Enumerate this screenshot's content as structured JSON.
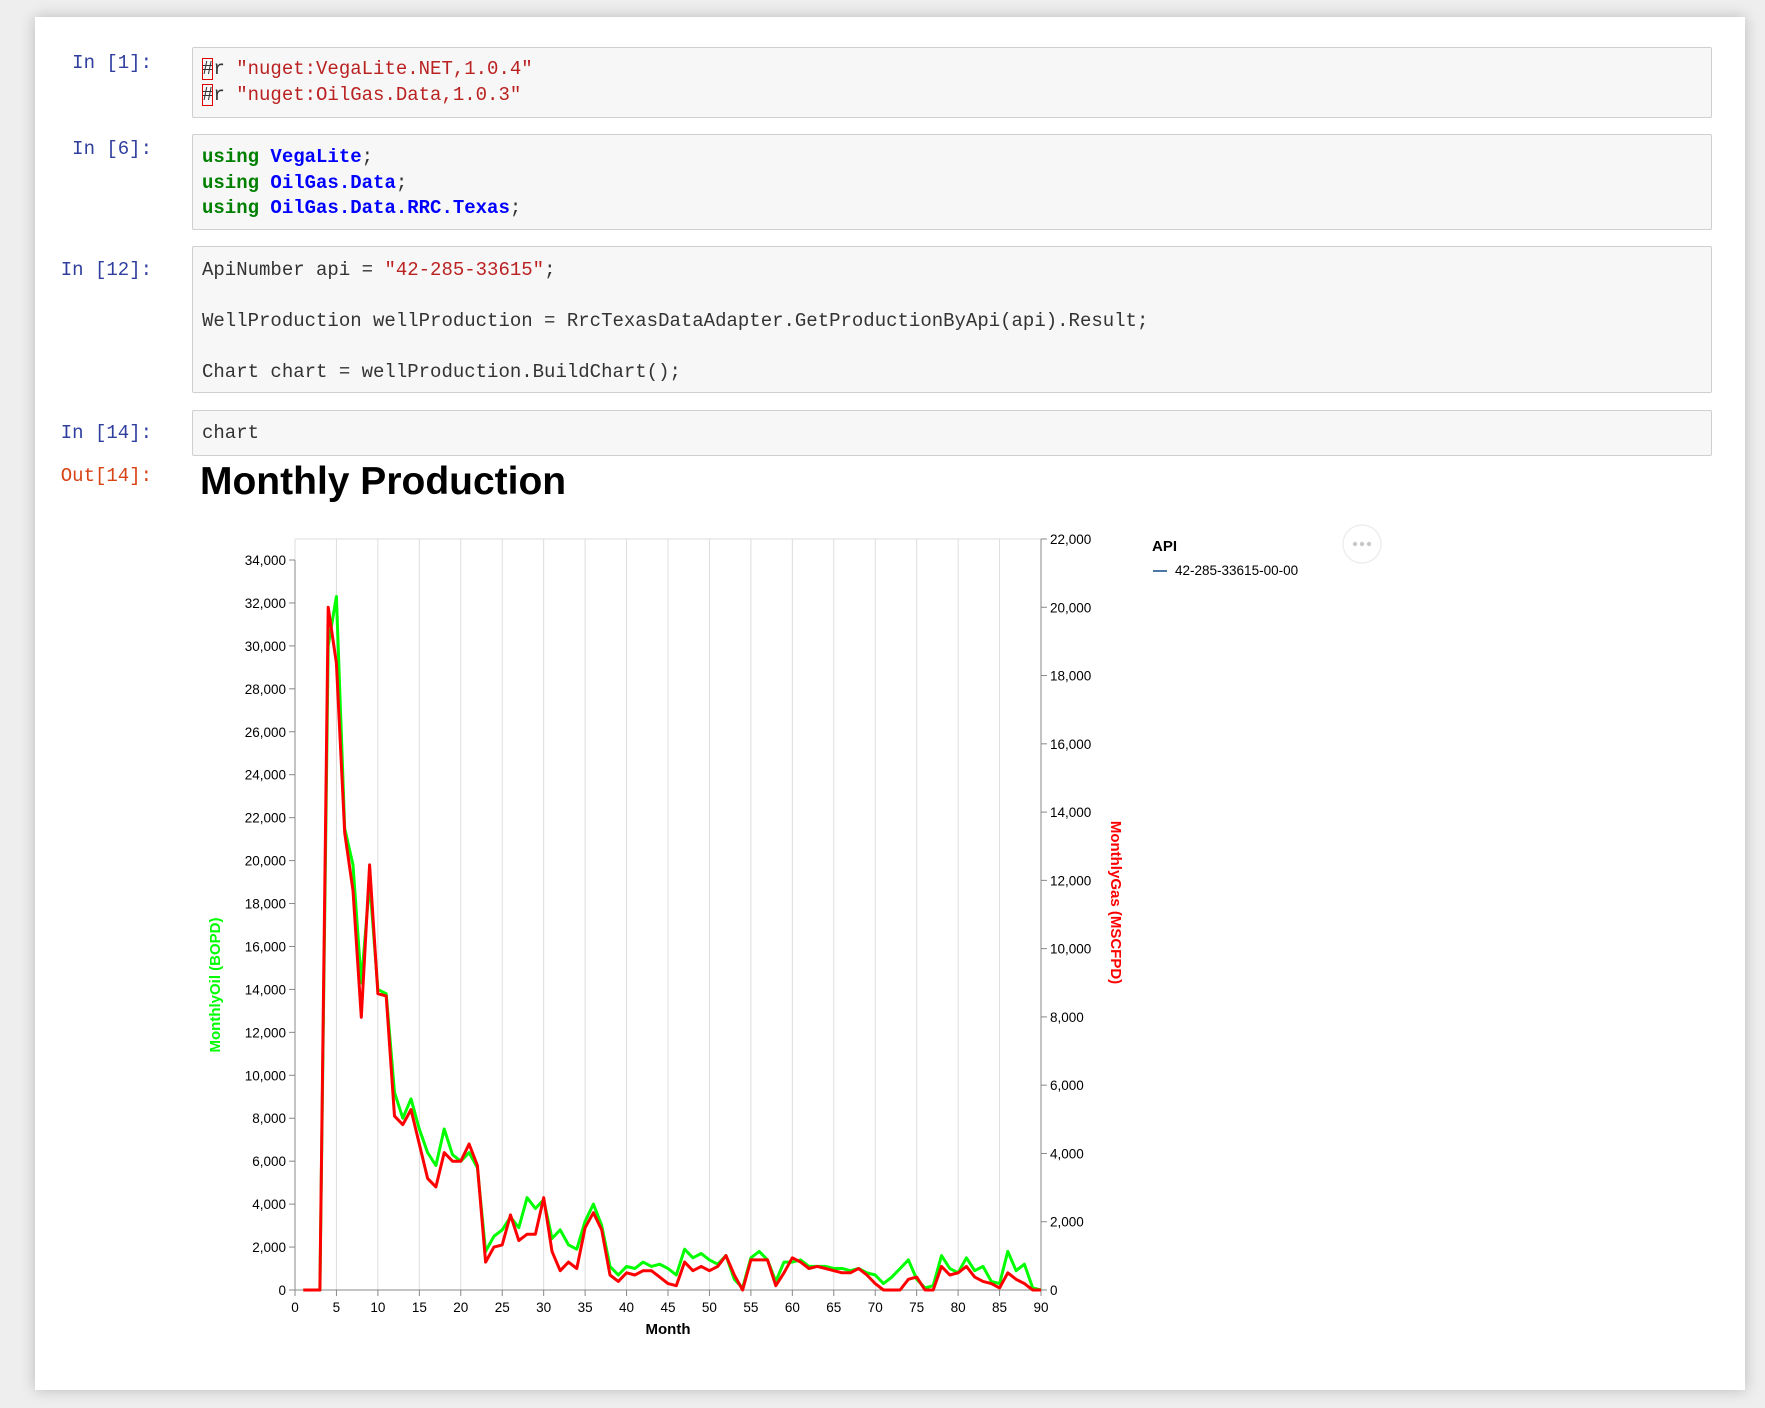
{
  "cells": [
    {
      "prompt": "In [1]:",
      "lines": [
        {
          "hash": "#",
          "rest": "r ",
          "string": "\"nuget:VegaLite.NET,1.0.4\""
        },
        {
          "hash": "#",
          "rest": "r ",
          "string": "\"nuget:OilGas.Data,1.0.3\""
        }
      ]
    },
    {
      "prompt": "In [6]:",
      "lines": [
        {
          "keyword": "using",
          "namespace": "VegaLite",
          "end": ";"
        },
        {
          "keyword": "using",
          "namespace": "OilGas.Data",
          "end": ";"
        },
        {
          "keyword": "using",
          "namespace": "OilGas.Data.RRC.Texas",
          "end": ";"
        }
      ]
    },
    {
      "prompt": "In [12]:",
      "lines": [
        {
          "code": "ApiNumber api = ",
          "string": "\"42-285-33615\"",
          "end": ";"
        },
        {
          "code": "WellProduction wellProduction = RrcTexasDataAdapter.GetProductionByApi(api).Result;"
        },
        {
          "code": "Chart chart = wellProduction.BuildChart();"
        }
      ]
    },
    {
      "prompt": "In [14]:",
      "lines": [
        {
          "code": "chart"
        }
      ]
    }
  ],
  "output": {
    "prompt": "Out[14]:",
    "actions_icon": "more-horizontal-icon"
  },
  "colors": {
    "oil": "#00ff00",
    "gas": "#ff0000",
    "legend_swatch": "#4c78a8",
    "grid": "#dddddd",
    "prompt_in": "#303f9f",
    "prompt_out": "#d84315"
  },
  "chart_data": {
    "type": "line",
    "title": "Monthly Production",
    "xlabel": "Month",
    "ylabel_left": "MonthlyOil (BOPD)",
    "ylabel_right": "MonthlyGas (MSCFPD)",
    "xlim": [
      0,
      90
    ],
    "ylim_left": [
      0,
      34000
    ],
    "ylim_right": [
      0,
      22000
    ],
    "x_ticks": [
      "0",
      "5",
      "10",
      "15",
      "20",
      "25",
      "30",
      "35",
      "40",
      "45",
      "50",
      "55",
      "60",
      "65",
      "70",
      "75",
      "80",
      "85",
      "90"
    ],
    "y_ticks_left": [
      "0",
      "2,000",
      "4,000",
      "6,000",
      "8,000",
      "10,000",
      "12,000",
      "14,000",
      "16,000",
      "18,000",
      "20,000",
      "22,000",
      "24,000",
      "26,000",
      "28,000",
      "30,000",
      "32,000",
      "34,000"
    ],
    "y_ticks_right": [
      "0",
      "2,000",
      "4,000",
      "6,000",
      "8,000",
      "10,000",
      "12,000",
      "14,000",
      "16,000",
      "18,000",
      "20,000",
      "22,000"
    ],
    "grid": "vertical",
    "legend": {
      "title": "API",
      "entries": [
        "42-285-33615-00-00"
      ],
      "position": "right"
    },
    "x": [
      1,
      2,
      3,
      4,
      5,
      6,
      7,
      8,
      9,
      10,
      11,
      12,
      13,
      14,
      15,
      16,
      17,
      18,
      19,
      20,
      21,
      22,
      23,
      24,
      25,
      26,
      27,
      28,
      29,
      30,
      31,
      32,
      33,
      34,
      35,
      36,
      37,
      38,
      39,
      40,
      41,
      42,
      43,
      44,
      45,
      46,
      47,
      48,
      49,
      50,
      51,
      52,
      53,
      54,
      55,
      56,
      57,
      58,
      59,
      60,
      61,
      62,
      63,
      64,
      65,
      66,
      67,
      68,
      69,
      70,
      71,
      72,
      73,
      74,
      75,
      76,
      77,
      78,
      79,
      80,
      81,
      82,
      83,
      84,
      85,
      86,
      87,
      88,
      89,
      90
    ],
    "series": [
      {
        "name": "MonthlyOil (BOPD)",
        "axis": "left",
        "values": [
          0,
          0,
          0,
          30000,
          32300,
          21500,
          19800,
          14300,
          19000,
          14000,
          13800,
          9200,
          8000,
          8900,
          7500,
          6400,
          5800,
          7500,
          6300,
          6000,
          6400,
          5700,
          1800,
          2500,
          2800,
          3400,
          2900,
          4300,
          3800,
          4200,
          2400,
          2800,
          2100,
          1900,
          3200,
          4000,
          3000,
          1100,
          700,
          1100,
          1000,
          1300,
          1100,
          1200,
          1000,
          700,
          1900,
          1500,
          1700,
          1400,
          1200,
          1600,
          500,
          100,
          1500,
          1800,
          1400,
          400,
          1300,
          1300,
          1400,
          1100,
          1100,
          1100,
          1000,
          1000,
          900,
          1000,
          800,
          700,
          300,
          600,
          1000,
          1400,
          500,
          100,
          200,
          1600,
          1000,
          800,
          1500,
          900,
          1100,
          400,
          300,
          1800,
          900,
          1200,
          100,
          0
        ]
      },
      {
        "name": "MonthlyGas (MSCFPD)",
        "axis": "left",
        "values": [
          0,
          0,
          0,
          31800,
          29200,
          21300,
          18600,
          12700,
          19800,
          13800,
          13700,
          8100,
          7700,
          8400,
          6800,
          5200,
          4800,
          6400,
          6000,
          6000,
          6800,
          5800,
          1300,
          2000,
          2100,
          3500,
          2300,
          2600,
          2600,
          4300,
          1800,
          900,
          1300,
          1000,
          2900,
          3600,
          2800,
          700,
          400,
          800,
          700,
          900,
          900,
          600,
          300,
          200,
          1300,
          900,
          1100,
          900,
          1100,
          1600,
          700,
          0,
          1400,
          1400,
          1400,
          200,
          800,
          1500,
          1300,
          1000,
          1100,
          1000,
          900,
          800,
          800,
          1000,
          700,
          300,
          0,
          0,
          0,
          500,
          600,
          0,
          0,
          1100,
          700,
          800,
          1100,
          600,
          400,
          300,
          100,
          800,
          500,
          300,
          0,
          0
        ]
      }
    ]
  }
}
